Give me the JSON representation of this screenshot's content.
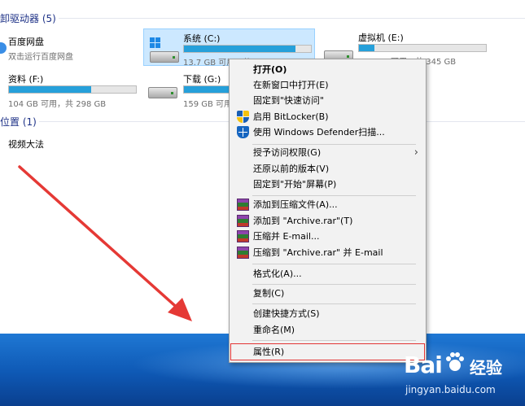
{
  "explorer": {
    "drives_header": "卸驱动器 (5)",
    "locations_header": "位置 (1)",
    "drives": [
      {
        "name": "百度网盘",
        "sub": "双击运行百度网盘"
      },
      {
        "name": "系统 (C:)",
        "sub": "13.7 GB 可用，共 118 GB",
        "fill_pct": 88
      },
      {
        "name": "虚拟机 (E:)",
        "sub": "303 GB 可用，共 345 GB",
        "fill_pct": 12
      },
      {
        "name": "资料 (F:)",
        "sub": "104 GB 可用，共 298 GB",
        "fill_pct": 65
      },
      {
        "name": "下载 (G:)",
        "sub": "159 GB 可用，共 298 GB",
        "fill_pct": 47
      }
    ],
    "locations": [
      {
        "name": "视频大法"
      }
    ]
  },
  "context_menu": {
    "items": [
      {
        "label": "打开(O)",
        "bold": true
      },
      {
        "label": "在新窗口中打开(E)"
      },
      {
        "label": "固定到\"快速访问\""
      },
      {
        "label": "启用 BitLocker(B)",
        "icon": "bitlocker-shield-icon"
      },
      {
        "label": "使用 Windows Defender扫描...",
        "icon": "windows-defender-icon"
      },
      {
        "label": "授予访问权限(G)",
        "submenu": true
      },
      {
        "label": "还原以前的版本(V)"
      },
      {
        "label": "固定到\"开始\"屏幕(P)"
      },
      {
        "label": "添加到压缩文件(A)...",
        "icon": "winrar-icon"
      },
      {
        "label": "添加到 \"Archive.rar\"(T)",
        "icon": "winrar-icon"
      },
      {
        "label": "压缩并 E-mail...",
        "icon": "winrar-icon"
      },
      {
        "label": "压缩到 \"Archive.rar\" 并 E-mail",
        "icon": "winrar-icon"
      },
      {
        "label": "格式化(A)..."
      },
      {
        "label": "复制(C)"
      },
      {
        "label": "创建快捷方式(S)"
      },
      {
        "label": "重命名(M)"
      },
      {
        "label": "属性(R)",
        "highlighted": true
      }
    ],
    "submenu_glyph": "›"
  },
  "watermark": {
    "logo": "Bai",
    "brand": "经验",
    "url": "jingyan.baidu.com"
  },
  "colors": {
    "accent": "#26a0da",
    "highlight_border": "#e23434",
    "arrow": "#e53935",
    "desktop": "#1565c0"
  }
}
